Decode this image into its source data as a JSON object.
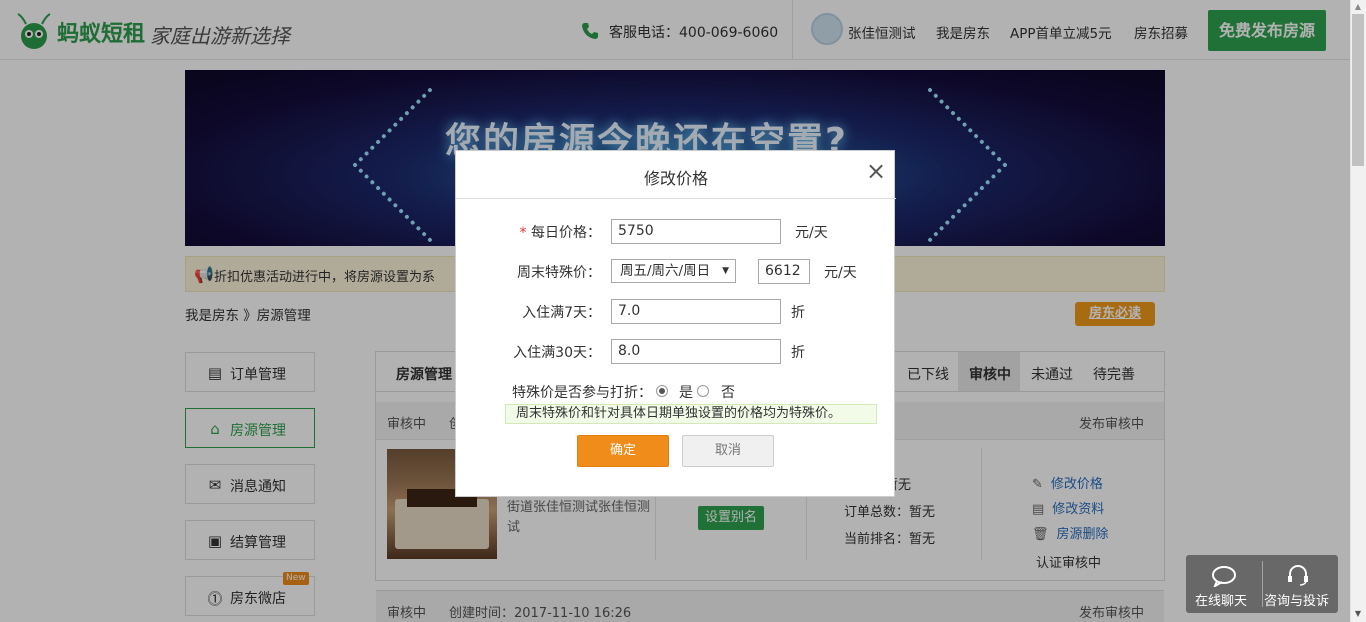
{
  "header": {
    "logo_text": "蚂蚁短租",
    "slogan": "家庭出游新选择",
    "phone": "客服电话：400-069-6060",
    "user_name": "张佳恒测试",
    "links": [
      "我是房东",
      "APP首单立减5元",
      "房东招募"
    ],
    "publish_button": "免费发布房源"
  },
  "banner": {
    "text": "您的房源今晚还在空置?"
  },
  "notice": {
    "text": "折扣优惠活动进行中，将房源设置为系"
  },
  "breadcrumb": "我是房东 》房源管理",
  "must_read": "房东必读",
  "sidebar": {
    "items": [
      {
        "label": "订单管理",
        "icon": "document-icon"
      },
      {
        "label": "房源管理",
        "icon": "house-icon",
        "active": true
      },
      {
        "label": "消息通知",
        "icon": "envelope-icon"
      },
      {
        "label": "结算管理",
        "icon": "clipboard-icon"
      },
      {
        "label": "房东微店",
        "icon": "shop-icon",
        "badge": "New"
      }
    ]
  },
  "tabs": {
    "first": "房源管理",
    "items": [
      "已下线",
      "审核中",
      "未通过",
      "待完善"
    ],
    "active": "审核中"
  },
  "listing": {
    "status": "审核中",
    "status_prefix_partial": "创",
    "status_right": "发布审核中",
    "address": "街道张佳恒测试张佳恒测试",
    "alias_button": "设置别名",
    "stats": [
      "：暂无",
      "订单总数：暂无",
      "当前排名：暂无"
    ],
    "actions": [
      "修改价格",
      "修改资料",
      "房源删除"
    ],
    "cert_status": "认证审核中"
  },
  "listing2": {
    "status": "审核中",
    "created": "创建时间：2017-11-10 16:26",
    "status_right": "发布审核中"
  },
  "modal": {
    "title": "修改价格",
    "close": "×",
    "daily_price_label": "每日价格：",
    "daily_price_value": "5750",
    "daily_unit": "元/天",
    "weekend_label": "周末特殊价：",
    "weekend_select": "周五/周六/周日",
    "weekend_value": "6612",
    "weekend_unit": "元/天",
    "stay7_label": "入住满7天：",
    "stay7_value": "7.0",
    "stay7_unit": "折",
    "stay30_label": "入住满30天：",
    "stay30_value": "8.0",
    "stay30_unit": "折",
    "discount_question": "特殊价是否参与打折：",
    "option_yes": "是",
    "option_no": "否",
    "hint": "周末特殊价和针对具体日期单独设置的价格均为特殊价。",
    "ok": "确定",
    "cancel": "取消"
  },
  "chat": {
    "online": "在线聊天",
    "consult": "咨询与投诉"
  },
  "colors": {
    "brand_green": "#2ea34f",
    "accent_orange": "#f08c1a"
  }
}
